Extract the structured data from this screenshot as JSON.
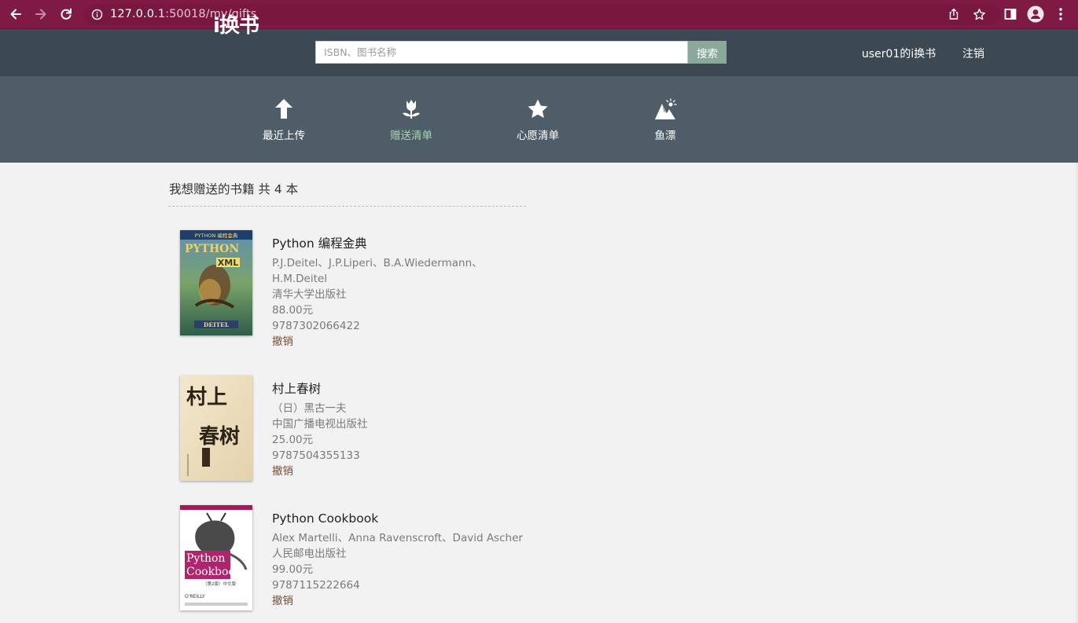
{
  "browser": {
    "url_host": "127.0.0.1",
    "url_rest": ":50018/my/gifts"
  },
  "header": {
    "logo": "i换书",
    "search_placeholder": "ISBN、图书名称",
    "search_button": "搜索",
    "user_link": "user01的i换书",
    "logout": "注销"
  },
  "nav": {
    "items": [
      {
        "label": "最近上传",
        "icon": "arrow-up-icon",
        "active": false
      },
      {
        "label": "赠送清单",
        "icon": "tulip-icon",
        "active": true
      },
      {
        "label": "心愿清单",
        "icon": "star-icon",
        "active": false
      },
      {
        "label": "鱼漂",
        "icon": "mountain-sun-icon",
        "active": false
      }
    ]
  },
  "main": {
    "title": "我想赠送的书籍 共 4 本",
    "books": [
      {
        "title": "Python 编程金典",
        "author_line1": "P.J.Deitel、J.P.Liperi、B.A.Wiedermann、",
        "author_line2": "H.M.Deitel",
        "publisher": "清华大学出版社",
        "price": "88.00元",
        "isbn": "9787302066422",
        "action": "撤销",
        "cover_title": "PYTHON",
        "cover_sub": "XML",
        "cover_author": "DEITEL",
        "cover_band": "PYTHON 编程金典"
      },
      {
        "title": "村上春树",
        "author_line1": "（日）黑古一夫",
        "publisher": "中国广播电视出版社",
        "price": "25.00元",
        "isbn": "9787504355133",
        "action": "撤销",
        "cover_title_1": "村上",
        "cover_title_2": "春树"
      },
      {
        "title": "Python Cookbook",
        "author_line1": "Alex Martelli、Anna Ravenscroft、David Ascher",
        "publisher": "人民邮电出版社",
        "price": "99.00元",
        "isbn": "9787115222664",
        "action": "撤销",
        "cover_title_1": "Python",
        "cover_title_2": "Cookbook",
        "cover_edition": "（第2版）中文版",
        "cover_publisher": "O'REILLY"
      }
    ]
  },
  "colors": {
    "chrome": "#7e1a43",
    "topbar": "#3c4953",
    "subnav": "#4f5d69",
    "active_nav": "#a6d6ae",
    "search_button": "#8aa99a",
    "revoke": "#7a4f3a"
  }
}
